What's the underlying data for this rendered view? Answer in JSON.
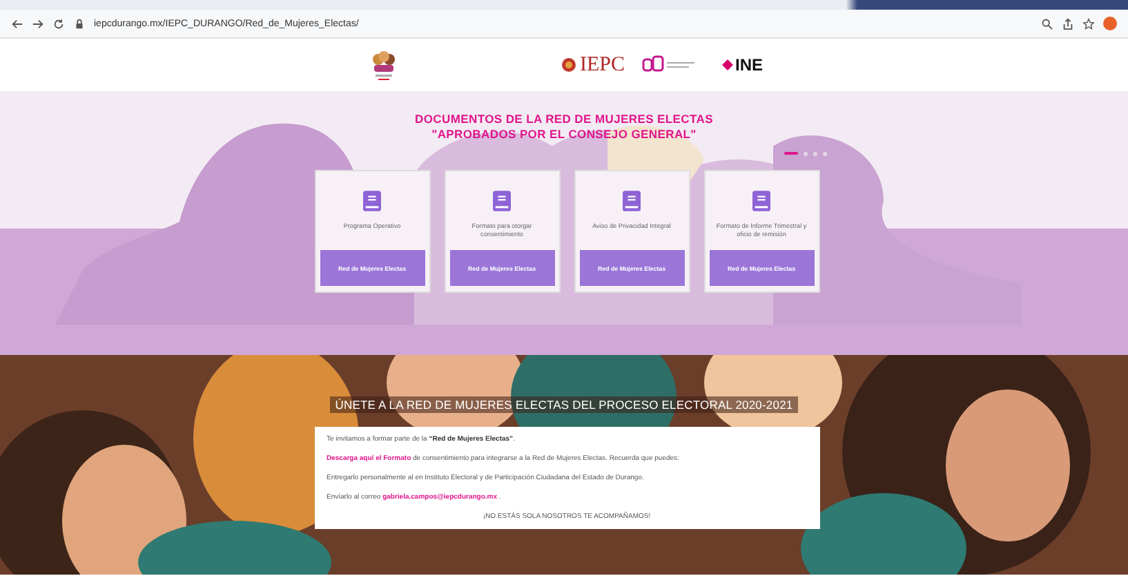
{
  "browser": {
    "url": "iepcdurango.mx/IEPC_DURANGO/Red_de_Mujeres_Electas/"
  },
  "header": {
    "logos": [
      {
        "kind": "emblem"
      },
      {
        "kind": "iepc",
        "text": "IEPC"
      },
      {
        "kind": "cbd"
      },
      {
        "kind": "ine",
        "text": "INE"
      }
    ]
  },
  "documents": {
    "title": "DOCUMENTOS DE LA RED DE MUJERES ELECTAS",
    "subtitle": "\"APROBADOS POR EL CONSEJO GENERAL\"",
    "slides": [
      {
        "selected": true
      },
      {
        "selected": false
      },
      {
        "selected": false
      },
      {
        "selected": false
      }
    ],
    "cards": [
      {
        "title": "Programa Operativo",
        "button": "Red de Mujeres Electas"
      },
      {
        "title": "Formato para otorgar consentimiento",
        "button": "Red de Mujeres Electas"
      },
      {
        "title": "Aviso de Privacidad Integral",
        "button": "Red de Mujeres Electas"
      },
      {
        "title": "Formato de Informe Trimestral y oficio de remisión",
        "button": "Red de Mujeres Electas"
      }
    ]
  },
  "join": {
    "title": "ÚNETE A LA RED DE MUJERES ELECTAS DEL PROCESO ELECTORAL 2020-2021",
    "paragraphs": [
      {
        "before": "Te invitamos a formar parte de la **“Red de Mujeres Electas”**."
      },
      {
        "link": "Descarga aquí el Formato",
        "after": " de consentimiento para integrarse a la Red de Mujeres Electas. Recuerda que puedes:"
      },
      {
        "before": "Entregarlo personalmente al en Instituto Electoral y de Participación Ciudadana del Estado de Durango."
      },
      {
        "before": "Envíarlo al correo ",
        "link": "gabriela.campos@iepcdurango.mx",
        "after": " ."
      }
    ],
    "closing": "¡NO ESTÁS SOLA NOSOTROS TE ACOMPAÑAMOS!"
  }
}
